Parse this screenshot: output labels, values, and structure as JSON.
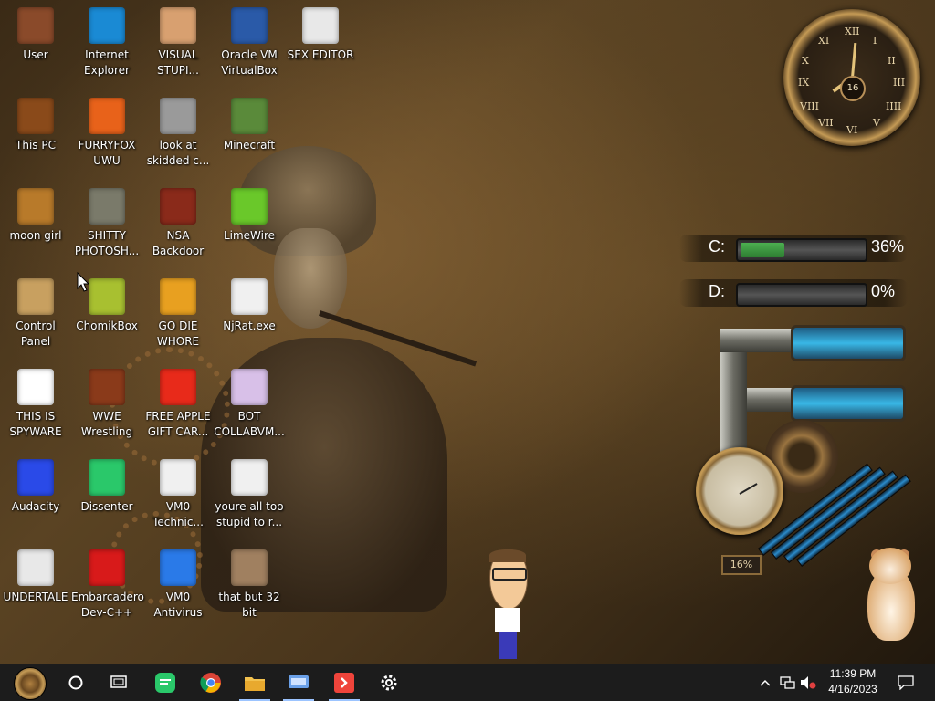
{
  "desktop": {
    "icons": [
      {
        "label": "User",
        "icon": "user-folder-icon",
        "color": "#8a4a2a"
      },
      {
        "label": "Internet Explorer",
        "icon": "edge-icon",
        "color": "#1a8ad4"
      },
      {
        "label": "VISUAL STUPI...",
        "icon": "cartoon-face-icon",
        "color": "#d8a070"
      },
      {
        "label": "Oracle VM VirtualBox",
        "icon": "virtualbox-icon",
        "color": "#2a5aa8"
      },
      {
        "label": "SEX EDITOR",
        "icon": "hxd-icon",
        "color": "#e8e8e8"
      },
      {
        "label": "This PC",
        "icon": "computer-icon",
        "color": "#8a4a1a"
      },
      {
        "label": "FURRYFOX UWU",
        "icon": "firefox-icon",
        "color": "#e8621a"
      },
      {
        "label": "look at skidded c...",
        "icon": "copies-icon",
        "color": "#9a9a9a"
      },
      {
        "label": "Minecraft",
        "icon": "minecraft-block-icon",
        "color": "#5a8a3a"
      },
      {
        "label": "moon girl",
        "icon": "book-icon",
        "color": "#b87a2a"
      },
      {
        "label": "SHITTY PHOTOSH...",
        "icon": "gimp-icon",
        "color": "#7a7a6a"
      },
      {
        "label": "NSA Backdoor",
        "icon": "window-icon",
        "color": "#8a2a1a"
      },
      {
        "label": "LimeWire",
        "icon": "limewire-icon",
        "color": "#6ac82a"
      },
      {
        "label": "Control Panel",
        "icon": "lightbulb-icon",
        "color": "#c8a060"
      },
      {
        "label": "ChomikBox",
        "icon": "chomikbox-icon",
        "color": "#a8c030"
      },
      {
        "label": "GO DIE WHORE",
        "icon": "de-icon",
        "color": "#e8a020"
      },
      {
        "label": "NjRat.exe",
        "icon": "skull-icon",
        "color": "#f0f0f0"
      },
      {
        "label": "THIS IS SPYWARE",
        "icon": "chrome-icon",
        "color": "#ffffff"
      },
      {
        "label": "WWE Wrestling",
        "icon": "tv-icon",
        "color": "#8a3a1a"
      },
      {
        "label": "FREE APPLE GIFT CAR...",
        "icon": "apple-icon",
        "color": "#e82a1a"
      },
      {
        "label": "BOT COLLABVM...",
        "icon": "monitor-icon",
        "color": "#d8c0e8"
      },
      {
        "label": "Audacity",
        "icon": "audacity-icon",
        "color": "#2a4ae8"
      },
      {
        "label": "Dissenter",
        "icon": "dissenter-icon",
        "color": "#2ac86a"
      },
      {
        "label": "VM0 Technic...",
        "icon": "technician-icon",
        "color": "#f0f0f0"
      },
      {
        "label": "youre all too stupid to r...",
        "icon": "portrait-sketch-icon",
        "color": "#f0f0f0"
      },
      {
        "label": "UNDERTALE",
        "icon": "unity-icon",
        "color": "#e8e8e8"
      },
      {
        "label": "Embarcadero Dev-C++",
        "icon": "devcpp-icon",
        "color": "#d81a1a"
      },
      {
        "label": "VM0 Antivirus",
        "icon": "shield-icon",
        "color": "#2a7ae8"
      },
      {
        "label": "that but 32 bit",
        "icon": "portrait-painting-icon",
        "color": "#a08060"
      }
    ]
  },
  "gadgets": {
    "clock": {
      "date": "16",
      "numerals": [
        "XII",
        "I",
        "II",
        "III",
        "IIII",
        "V",
        "VI",
        "VII",
        "VIII",
        "IX",
        "X",
        "XI"
      ]
    },
    "drives": [
      {
        "letter": "C:",
        "percent_text": "36%",
        "fill": 0.36
      },
      {
        "letter": "D:",
        "percent_text": "0%",
        "fill": 0.0
      }
    ],
    "meter": {
      "percent_text": "16%"
    }
  },
  "taskbar": {
    "pinned": [
      {
        "name": "cortana",
        "icon": "circle-icon"
      },
      {
        "name": "task-view",
        "icon": "task-view-icon"
      },
      {
        "name": "dissenter",
        "icon": "dissenter-icon"
      },
      {
        "name": "chrome",
        "icon": "chrome-icon"
      },
      {
        "name": "file-explorer",
        "icon": "folder-icon"
      },
      {
        "name": "remote",
        "icon": "keyboard-icon"
      },
      {
        "name": "anydesk",
        "icon": "anydesk-icon"
      },
      {
        "name": "settings",
        "icon": "gear-icon"
      }
    ],
    "time": "11:39 PM",
    "date": "4/16/2023",
    "accent": "#9cc4ff"
  }
}
